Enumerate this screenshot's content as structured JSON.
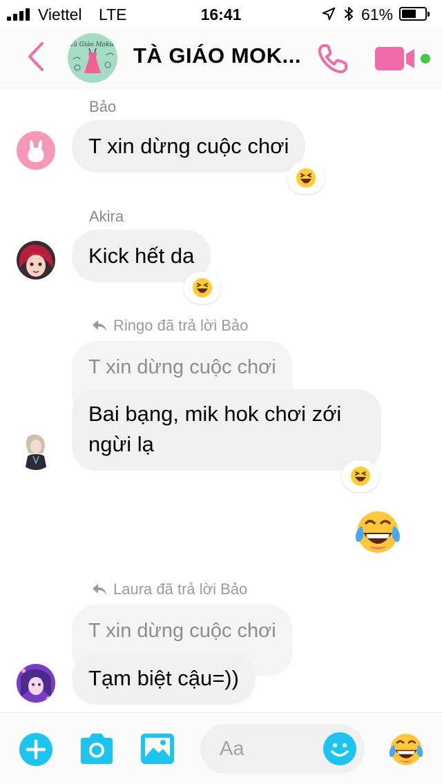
{
  "status_bar": {
    "carrier": "Viettel",
    "network": "LTE",
    "time": "16:41",
    "battery_percent_text": "61%",
    "battery_level": 0.61,
    "signal_bars": 4
  },
  "header": {
    "title": "TÀ GIÁO MOK...",
    "avatar_text": "Tà Giáo Mokie",
    "accent_color": "#f06ba7",
    "online_color": "#42c944",
    "icons": {
      "back": "chevron-left-icon",
      "call": "phone-icon",
      "video": "video-camera-icon"
    }
  },
  "messages": [
    {
      "sender": "Bảo",
      "text": "T xin dừng cuộc chơi",
      "reaction": "laughing-emoji"
    },
    {
      "sender": "Akira",
      "text": "Kick hết da",
      "reaction": "laughing-emoji"
    },
    {
      "reply_hint": "Ringo đã trả lời Bảo",
      "quoted_text": "T xin dừng cuộc chơi",
      "text_line1": "Bai bạng, mik hok chơi zới",
      "text_line2": "ngừi lạ",
      "reaction": "laughing-emoji"
    },
    {
      "outgoing_emoji": "tears-of-joy-emoji"
    },
    {
      "reply_hint": "Laura đã trả lời Bảo",
      "quoted_text": "T xin dừng cuộc chơi",
      "text": "Tạm biệt cậu=))"
    }
  ],
  "composer": {
    "placeholder": "Aa",
    "accent_color": "#1ec4f0",
    "icons": [
      "plus-icon",
      "camera-icon",
      "photo-icon",
      "smiley-icon",
      "tears-of-joy-emoji"
    ]
  }
}
